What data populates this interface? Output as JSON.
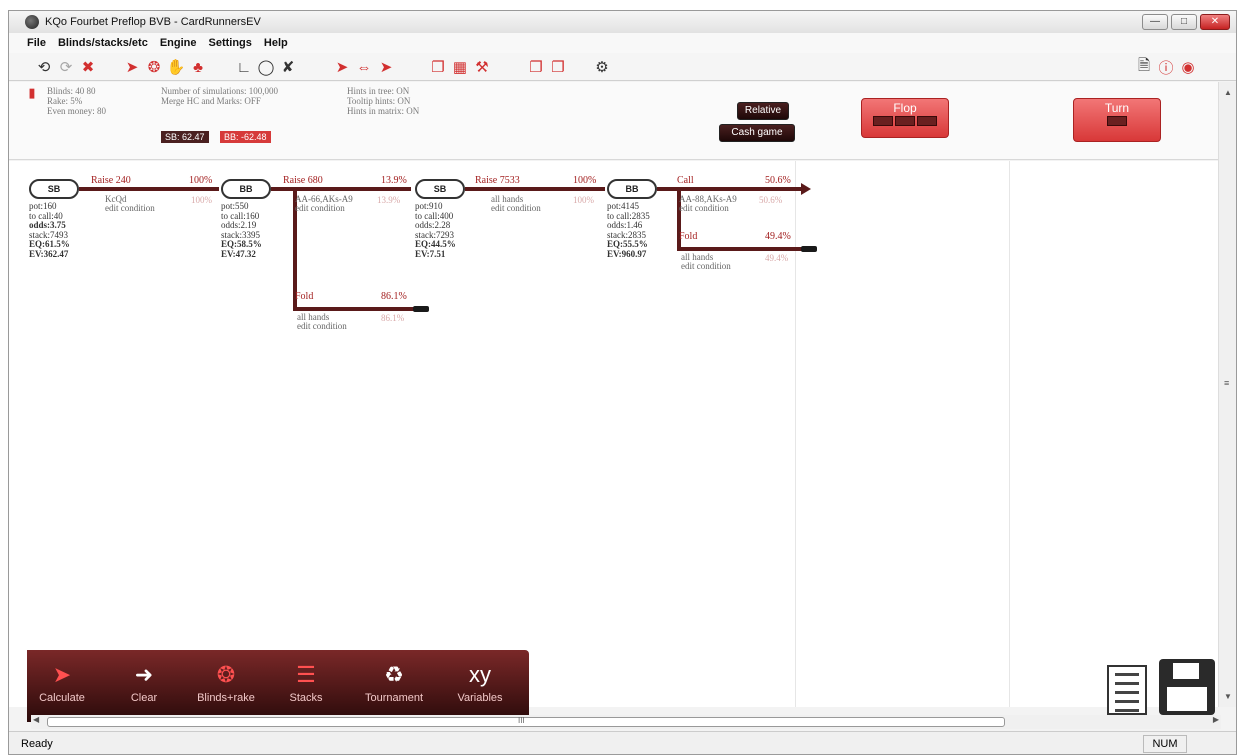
{
  "window": {
    "title": "KQo Fourbet Preflop BVB - CardRunnersEV"
  },
  "menu": [
    "File",
    "Blinds/stacks/etc",
    "Engine",
    "Settings",
    "Help"
  ],
  "info": {
    "col1": [
      "Blinds: 40 80",
      "Rake: 5%",
      "Even money: 80"
    ],
    "col2": [
      "Number of simulations: 100,000",
      "Merge HC and Marks: OFF"
    ],
    "col3": [
      "Hints in tree: ON",
      "Tooltip hints: ON",
      "Hints in matrix: ON"
    ],
    "sb_badge": "SB: 62.47",
    "bb_badge": "BB: -62.48",
    "relative_label": "Relative",
    "cash_game_label": "Cash game",
    "flop_label": "Flop",
    "turn_label": "Turn"
  },
  "tree": {
    "nodes": [
      {
        "label": "SB",
        "stats": [
          "pot:160",
          "to call:40",
          "odds:3.75",
          "stack:7493",
          "EQ:61.5%",
          "EV:362.47"
        ]
      },
      {
        "label": "BB",
        "stats": [
          "pot:550",
          "to call:160",
          "odds:2.19",
          "stack:3395",
          "EQ:58.5%",
          "EV:47.32"
        ]
      },
      {
        "label": "SB",
        "stats": [
          "pot:910",
          "to call:400",
          "odds:2.28",
          "stack:7293",
          "EQ:44.5%",
          "EV:7.51"
        ]
      },
      {
        "label": "BB",
        "stats": [
          "pot:4145",
          "to call:2835",
          "odds:1.46",
          "stack:2835",
          "EQ:55.5%",
          "EV:960.97"
        ]
      }
    ],
    "actions": [
      {
        "label": "Raise 240",
        "pct": "100%",
        "range": "KcQd",
        "cond": "edit condition",
        "faded": "100%"
      },
      {
        "label": "Raise 680",
        "pct": "13.9%",
        "range": "AA-66,AKs-A9",
        "cond": "edit condition",
        "faded": "13.9%"
      },
      {
        "label": "Fold",
        "pct": "86.1%",
        "range": "all hands",
        "cond": "edit condition",
        "faded": "86.1%"
      },
      {
        "label": "Raise 7533",
        "pct": "100%",
        "range": "all hands",
        "cond": "edit condition",
        "faded": "100%"
      },
      {
        "label": "Call",
        "pct": "50.6%",
        "range": "AA-88,AKs-A9",
        "cond": "edit condition",
        "faded": "50.6%"
      },
      {
        "label": "Fold",
        "pct": "49.4%",
        "range": "all hands",
        "cond": "edit condition",
        "faded": "49.4%"
      }
    ]
  },
  "bottom_toolbar": [
    {
      "label": "Calculate",
      "icon": "calculate-ev-icon"
    },
    {
      "label": "Clear",
      "icon": "arrow-right-icon"
    },
    {
      "label": "Blinds+rake",
      "icon": "chip-icon"
    },
    {
      "label": "Stacks",
      "icon": "chip-stack-icon"
    },
    {
      "label": "Tournament",
      "icon": "tournament-icon"
    },
    {
      "label": "Variables",
      "icon": "xy-icon"
    }
  ],
  "scrollbar_marker": "III",
  "status": {
    "text": "Ready",
    "num": "NUM"
  },
  "colors": {
    "accent": "#d83838",
    "dark_accent": "#4a2020",
    "edge": "#5a1a1a"
  }
}
